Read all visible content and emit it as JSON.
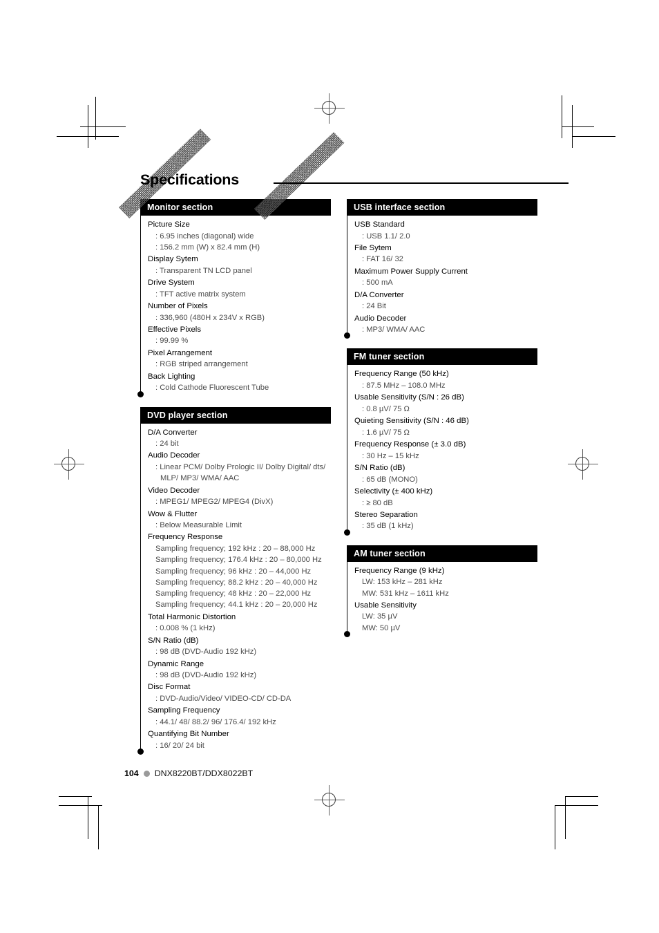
{
  "page": {
    "title": "Specifications",
    "footer": {
      "page_number": "104",
      "model": "DNX8220BT/DDX8022BT",
      "dot_color": "#9a9a9a"
    }
  },
  "columns": {
    "left": [
      {
        "heading": "Monitor section",
        "specs": [
          {
            "label": "Picture Size",
            "values": [
              ": 6.95 inches (diagonal) wide",
              ": 156.2 mm (W) x 82.4 mm (H)"
            ]
          },
          {
            "label": "Display Sytem",
            "values": [
              ": Transparent TN LCD panel"
            ]
          },
          {
            "label": "Drive System",
            "values": [
              ": TFT active matrix system"
            ]
          },
          {
            "label": "Number of Pixels",
            "values": [
              ": 336,960 (480H x 234V x RGB)"
            ]
          },
          {
            "label": "Effective Pixels",
            "values": [
              ": 99.99 %"
            ]
          },
          {
            "label": "Pixel Arrangement",
            "values": [
              ": RGB striped arrangement"
            ]
          },
          {
            "label": "Back Lighting",
            "values": [
              ": Cold Cathode Fluorescent Tube"
            ]
          }
        ]
      },
      {
        "heading": "DVD player section",
        "specs": [
          {
            "label": "D/A Converter",
            "values": [
              ": 24 bit"
            ]
          },
          {
            "label": "Audio Decoder",
            "values": [
              ": Linear PCM/ Dolby Prologic II/ Dolby Digital/ dts/",
              "MLP/ MP3/ WMA/ AAC"
            ],
            "continuation": [
              false,
              true
            ]
          },
          {
            "label": "Video Decoder",
            "values": [
              ": MPEG1/ MPEG2/ MPEG4 (DivX)"
            ]
          },
          {
            "label": "Wow & Flutter",
            "values": [
              ": Below Measurable Limit"
            ]
          },
          {
            "label": "Frequency Response",
            "values": [
              "Sampling frequency; 192 kHz : 20 – 88,000 Hz",
              "Sampling frequency; 176.4 kHz : 20 – 80,000 Hz",
              "Sampling frequency; 96 kHz : 20 – 44,000 Hz",
              "Sampling frequency; 88.2 kHz : 20 – 40,000 Hz",
              "Sampling frequency; 48 kHz : 20 – 22,000 Hz",
              "Sampling frequency; 44.1 kHz : 20 – 20,000 Hz"
            ]
          },
          {
            "label": "Total Harmonic Distortion",
            "values": [
              ": 0.008 % (1 kHz)"
            ]
          },
          {
            "label": "S/N Ratio (dB)",
            "values": [
              ": 98 dB (DVD-Audio 192 kHz)"
            ]
          },
          {
            "label": "Dynamic Range",
            "values": [
              ": 98 dB (DVD-Audio 192 kHz)"
            ]
          },
          {
            "label": "Disc Format",
            "values": [
              ": DVD-Audio/Video/ VIDEO-CD/ CD-DA"
            ]
          },
          {
            "label": "Sampling Frequency",
            "values": [
              ": 44.1/ 48/ 88.2/ 96/ 176.4/ 192 kHz"
            ]
          },
          {
            "label": "Quantifying Bit Number",
            "values": [
              ": 16/ 20/ 24 bit"
            ]
          }
        ]
      }
    ],
    "right": [
      {
        "heading": "USB interface section",
        "specs": [
          {
            "label": "USB Standard",
            "values": [
              ": USB 1.1/ 2.0"
            ]
          },
          {
            "label": "File Sytem",
            "values": [
              ": FAT 16/ 32"
            ]
          },
          {
            "label": "Maximum Power Supply Current",
            "values": [
              ": 500 mA"
            ]
          },
          {
            "label": "D/A Converter",
            "values": [
              ": 24 Bit"
            ]
          },
          {
            "label": "Audio Decoder",
            "values": [
              ": MP3/ WMA/ AAC"
            ]
          }
        ]
      },
      {
        "heading": "FM tuner section",
        "specs": [
          {
            "label": "Frequency Range (50 kHz)",
            "values": [
              ": 87.5 MHz – 108.0 MHz"
            ]
          },
          {
            "label": "Usable Sensitivity (S/N : 26 dB)",
            "values": [
              ": 0.8 µV/ 75 Ω"
            ]
          },
          {
            "label": "Quieting Sensitivity (S/N : 46 dB)",
            "values": [
              ": 1.6 µV/ 75 Ω"
            ]
          },
          {
            "label": "Frequency Response (± 3.0 dB)",
            "values": [
              ": 30 Hz – 15 kHz"
            ]
          },
          {
            "label": "S/N Ratio (dB)",
            "values": [
              ": 65 dB (MONO)"
            ]
          },
          {
            "label": "Selectivity (± 400 kHz)",
            "values": [
              ": ≥ 80 dB"
            ]
          },
          {
            "label": "Stereo Separation",
            "values": [
              ": 35 dB (1 kHz)"
            ]
          }
        ]
      },
      {
        "heading": "AM tuner section",
        "specs": [
          {
            "label": "Frequency Range (9 kHz)",
            "values": [
              "LW: 153 kHz – 281 kHz",
              "MW: 531 kHz – 1611 kHz"
            ]
          },
          {
            "label": "Usable Sensitivity",
            "values": [
              "LW: 35 µV",
              "MW: 50 µV"
            ]
          }
        ]
      }
    ]
  }
}
